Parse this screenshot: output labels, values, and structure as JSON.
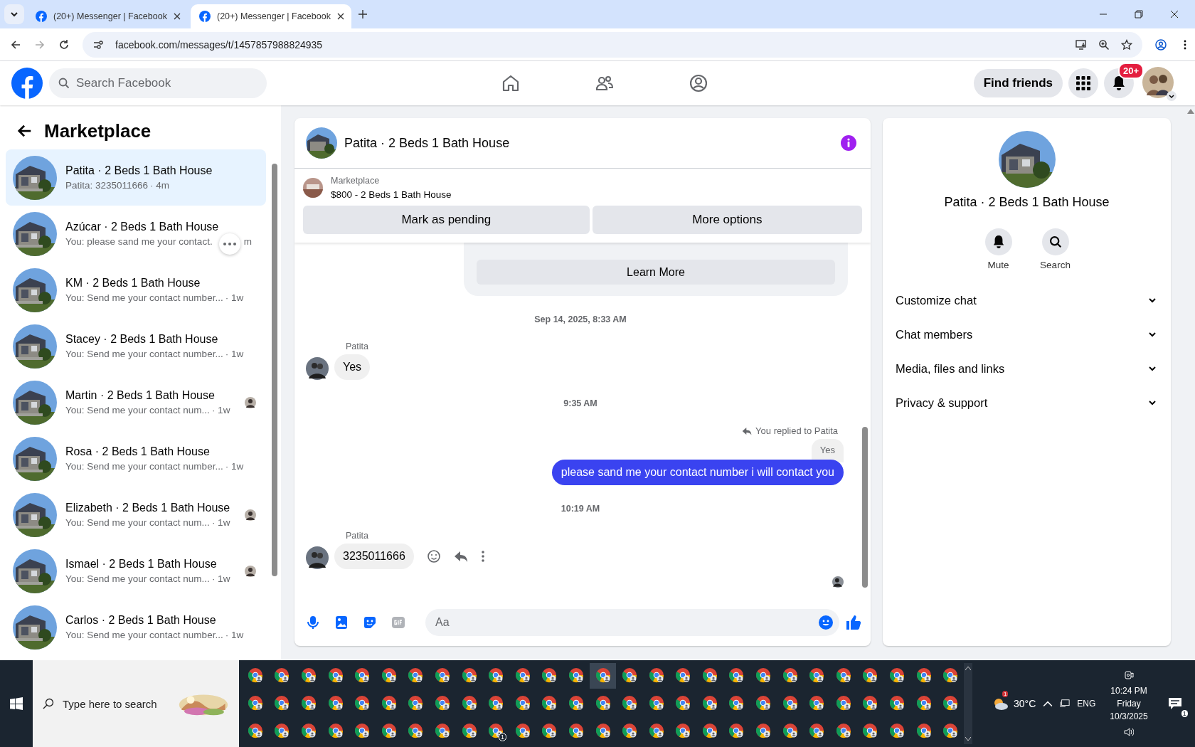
{
  "browser": {
    "tabs": [
      {
        "title": "(20+) Messenger | Facebook",
        "selected": false
      },
      {
        "title": "(20+) Messenger | Facebook",
        "selected": true
      }
    ],
    "url": "facebook.com/messages/t/1457857988824935"
  },
  "header": {
    "search_placeholder": "Search Facebook",
    "nav": [
      {
        "kind": "home"
      },
      {
        "kind": "friends"
      },
      {
        "kind": "profile"
      }
    ],
    "find_friends": "Find friends",
    "notification_badge": "20+"
  },
  "sidebar": {
    "title": "Marketplace",
    "conversations": [
      {
        "name": "Patita · 2 Beds 1 Bath House",
        "preview": "Patita: 3235011666",
        "time": "· 4m",
        "selected": true,
        "hover": false,
        "seen": false
      },
      {
        "name": "Azúcar · 2 Beds 1 Bath House",
        "preview": "You: please sand me your contact.",
        "time": "m",
        "selected": false,
        "hover": true,
        "seen": false
      },
      {
        "name": "KM · 2 Beds 1 Bath House",
        "preview": "You: Send me your contact number...",
        "time": "· 1w",
        "selected": false,
        "hover": false,
        "seen": false
      },
      {
        "name": "Stacey · 2 Beds 1 Bath House",
        "preview": "You: Send me your contact number...",
        "time": "· 1w",
        "selected": false,
        "hover": false,
        "seen": false
      },
      {
        "name": "Martin · 2 Beds 1 Bath House",
        "preview": "You: Send me your contact num...",
        "time": "· 1w",
        "selected": false,
        "hover": false,
        "seen": true
      },
      {
        "name": "Rosa · 2 Beds 1 Bath House",
        "preview": "You: Send me your contact number...",
        "time": "· 1w",
        "selected": false,
        "hover": false,
        "seen": false
      },
      {
        "name": "Elizabeth · 2 Beds 1 Bath House",
        "preview": "You: Send me your contact num...",
        "time": "· 1w",
        "selected": false,
        "hover": false,
        "seen": true
      },
      {
        "name": "Ismael · 2 Beds 1 Bath House",
        "preview": "You: Send me your contact num...",
        "time": "· 1w",
        "selected": false,
        "hover": false,
        "seen": true
      },
      {
        "name": "Carlos · 2 Beds 1 Bath House",
        "preview": "You: Send me your contact number...",
        "time": "· 1w",
        "selected": false,
        "hover": false,
        "seen": false
      }
    ]
  },
  "chat": {
    "title": "Patita · 2 Beds 1 Bath House",
    "listing": {
      "source": "Marketplace",
      "title": "$800 - 2 Beds 1 Bath House",
      "buttons": [
        "Mark as pending",
        "More options"
      ]
    },
    "learn_more": "Learn More",
    "messages": [
      {
        "kind": "timestamp",
        "text": "Sep 14, 2025, 8:33 AM"
      },
      {
        "kind": "incoming",
        "sender": "Patita",
        "text": "Yes",
        "actions": false
      },
      {
        "kind": "timestamp",
        "text": "9:35 AM"
      },
      {
        "kind": "outgoing_reply",
        "reply_label": "You replied to Patita",
        "quoted": "Yes",
        "text": "please sand me your contact number i will contact you"
      },
      {
        "kind": "timestamp",
        "text": "10:19 AM"
      },
      {
        "kind": "incoming",
        "sender": "Patita",
        "text": "3235011666",
        "actions": true
      }
    ],
    "composer_placeholder": "Aa"
  },
  "details": {
    "name": "Patita · 2 Beds 1 Bath House",
    "actions": [
      {
        "kind": "mute",
        "label": "Mute"
      },
      {
        "kind": "search",
        "label": "Search"
      }
    ],
    "sections": [
      {
        "label": "Customize chat",
        "expanded": false
      },
      {
        "label": "Chat members",
        "expanded": false
      },
      {
        "label": "Media, files and links",
        "expanded": false
      },
      {
        "label": "Privacy & support",
        "expanded": false
      }
    ]
  },
  "taskbar": {
    "search_placeholder": "Type here to search",
    "app_badge": "1",
    "weather_badge": "1",
    "temperature": "30°C",
    "language": "ENG",
    "time": "10:24 PM",
    "day": "Friday",
    "date": "10/3/2025",
    "notification_count": "1"
  }
}
